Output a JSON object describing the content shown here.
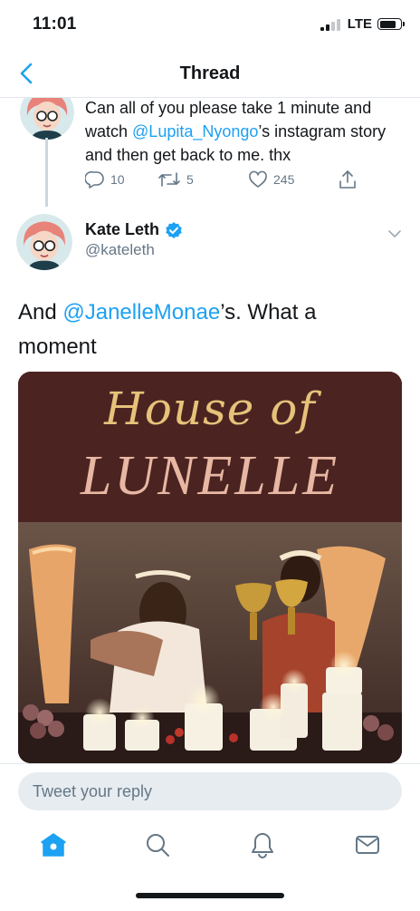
{
  "status_bar": {
    "time": "11:01",
    "network": "LTE"
  },
  "nav": {
    "title": "Thread"
  },
  "previous_tweet": {
    "text_part1": "Can all of you please take 1 minute and watch ",
    "mention": "@Lupita_Nyongo",
    "text_part2": "’s instagram story and then get back to me. thx",
    "replies": "10",
    "retweets": "5",
    "likes": "245"
  },
  "main_tweet": {
    "author_name": "Kate Leth",
    "author_handle": "@kateleth",
    "text_part1": "And ",
    "mention": "@JanelleMonae",
    "text_part2": "’s. What a moment",
    "media": {
      "title_line1": "House of",
      "title_line2": "LUNELLE"
    }
  },
  "reply": {
    "placeholder": "Tweet your reply"
  },
  "tab_bar": {
    "icons": [
      "home-icon",
      "search-icon",
      "notifications-icon",
      "messages-icon"
    ]
  },
  "colors": {
    "accent": "#1da1f2",
    "text": "#14171a",
    "muted": "#657786",
    "media_bg": "#4b2421"
  }
}
